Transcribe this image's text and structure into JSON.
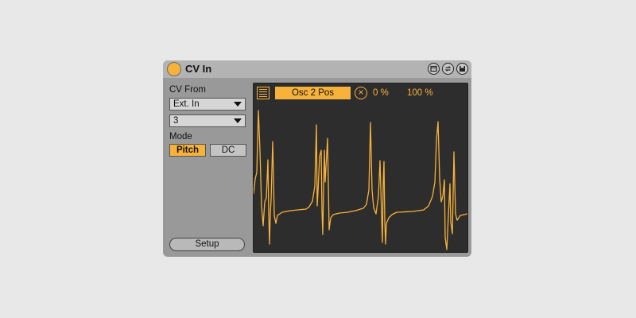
{
  "device": {
    "title": "CV In",
    "header_icons": [
      "maximize-icon",
      "hot-swap-icon",
      "save-icon"
    ]
  },
  "controls": {
    "cv_from_label": "CV From",
    "source_value": "Ext. In",
    "channel_value": "3",
    "mode_label": "Mode",
    "mode_options": [
      "Pitch",
      "DC"
    ],
    "mode_selected": "Pitch",
    "setup_label": "Setup"
  },
  "scope": {
    "target_label": "Osc 2 Pos",
    "min_label": "0 %",
    "max_label": "100 %"
  },
  "colors": {
    "accent": "#f7b23b",
    "scope_bg": "#2d2d2d",
    "panel": "#999999"
  }
}
